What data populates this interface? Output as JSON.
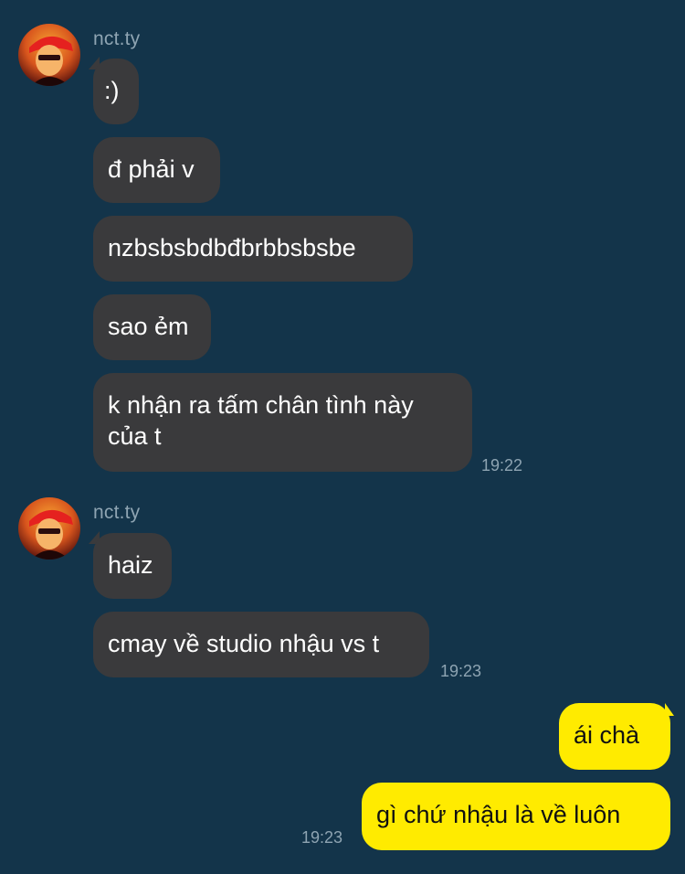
{
  "colors": {
    "background": "#13344a",
    "incoming_bubble": "#3a3a3c",
    "outgoing_bubble": "#ffeb00",
    "meta_text": "#8ea4b2"
  },
  "groups": [
    {
      "sender": "nct.ty",
      "avatar_icon": "user-avatar-icon",
      "messages": [
        ":)",
        "đ phải v",
        "nzbsbsbdbđbrbbsbsbe",
        "sao ẻm",
        "k nhận ra tấm chân tình này của t"
      ],
      "time": "19:22"
    },
    {
      "sender": "nct.ty",
      "avatar_icon": "user-avatar-icon",
      "messages": [
        "haiz",
        "cmay về studio nhậu vs t"
      ],
      "time": "19:23"
    }
  ],
  "outgoing": {
    "messages": [
      "ái chà",
      "gì chứ nhậu là về luôn"
    ],
    "time": "19:23"
  }
}
